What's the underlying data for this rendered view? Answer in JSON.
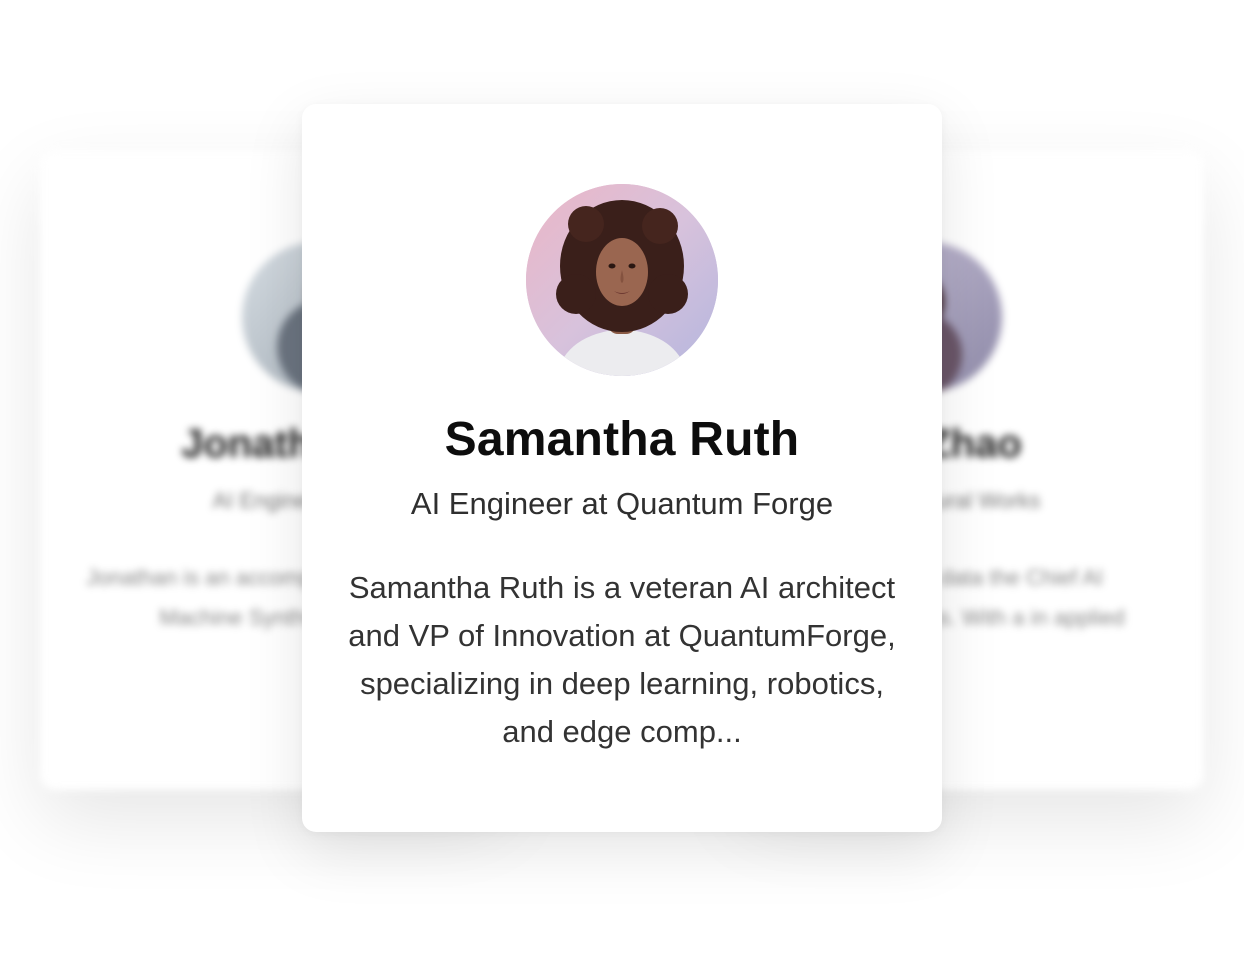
{
  "left_card": {
    "name": "Jonathan",
    "role": "AI Engineer",
    "bio": "Jonathan is an accomplished Head of Machine SynthCore, w"
  },
  "right_card": {
    "name": "Zhao",
    "role": "Neural Works",
    "bio": "a leading data the Chief AI NeuralWorks. With a in applied"
  },
  "featured_card": {
    "name": "Samantha Ruth",
    "role": "AI Engineer at Quantum Forge",
    "bio": "Samantha Ruth is a veteran AI architect and VP of Innovation at QuantumForge, specializing in deep learning, robotics, and edge comp...",
    "avatar_icon": "portrait-avatar"
  }
}
